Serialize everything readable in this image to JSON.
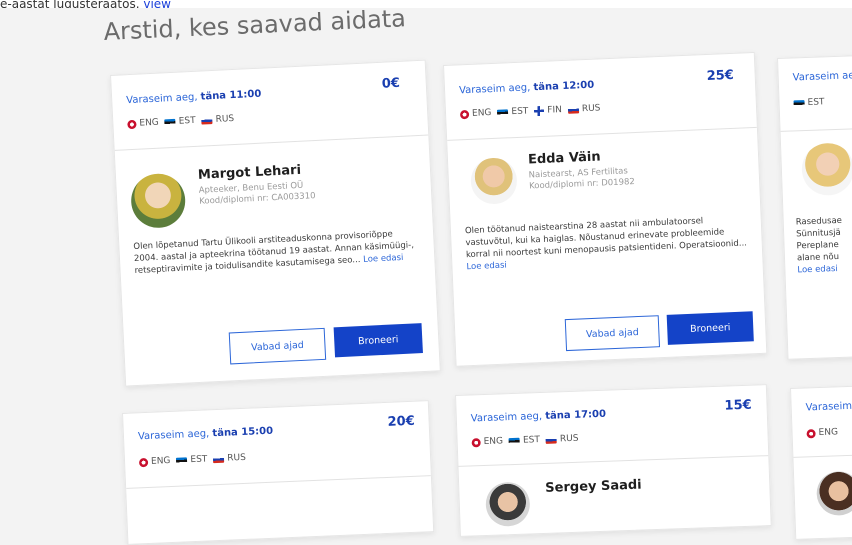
{
  "topline": {
    "text": "e-aastat lugusteraatos.",
    "link": "view"
  },
  "heading": "Arstid, kes saavad aidata",
  "cards": [
    {
      "earliest_label": "Varaseim aeg,",
      "earliest_time": "täna 11:00",
      "price": "0€",
      "languages": [
        "ENG",
        "EST",
        "RUS"
      ],
      "name": "Margot Lehari",
      "role": "Apteeker, Benu Eesti OÜ",
      "code": "Kood/diplomi nr: CA003310",
      "bio": "Olen lõpetanud Tartu Ülikooli arstiteaduskonna provisoriõppe 2004. aastal ja apteekrina töötanud 19 aastat. Annan käsimüügi-, retseptiravimite ja toidulisandite kasutamisega seo...",
      "more": "Loe edasi",
      "free_label": "Vabad ajad",
      "book_label": "Broneeri"
    },
    {
      "earliest_label": "Varaseim aeg,",
      "earliest_time": "täna 12:00",
      "price": "25€",
      "languages": [
        "ENG",
        "EST",
        "FIN",
        "RUS"
      ],
      "name": "Edda Väin",
      "role": "Naistearst, AS Fertilitas",
      "code": "Kood/diplomi nr: D01982",
      "bio": "Olen töötanud naistearstina 28 aastat nii ambulatoorsel vastuvõtul, kui ka haiglas. Nõustanud erinevate probleemide korral nii noortest kuni menopausis patsientideni. Operatsioonid...",
      "more": "Loe edasi",
      "free_label": "Vabad ajad",
      "book_label": "Broneeri"
    },
    {
      "earliest_label": "Varaseim aeg",
      "languages": [
        "EST"
      ],
      "bio_lines": [
        "Rasedusae",
        "Sünnitusjä",
        "Pereplane",
        "alane nõu"
      ],
      "more": "Loe edasi"
    },
    {
      "earliest_label": "Varaseim aeg,",
      "earliest_time": "täna 15:00",
      "price": "20€",
      "languages": [
        "ENG",
        "EST",
        "RUS"
      ]
    },
    {
      "earliest_label": "Varaseim aeg,",
      "earliest_time": "täna 17:00",
      "price": "15€",
      "languages": [
        "ENG",
        "EST",
        "RUS"
      ],
      "name": "Sergey Saadi"
    },
    {
      "earliest_label": "Varaseim",
      "languages": [
        "ENG"
      ]
    }
  ]
}
